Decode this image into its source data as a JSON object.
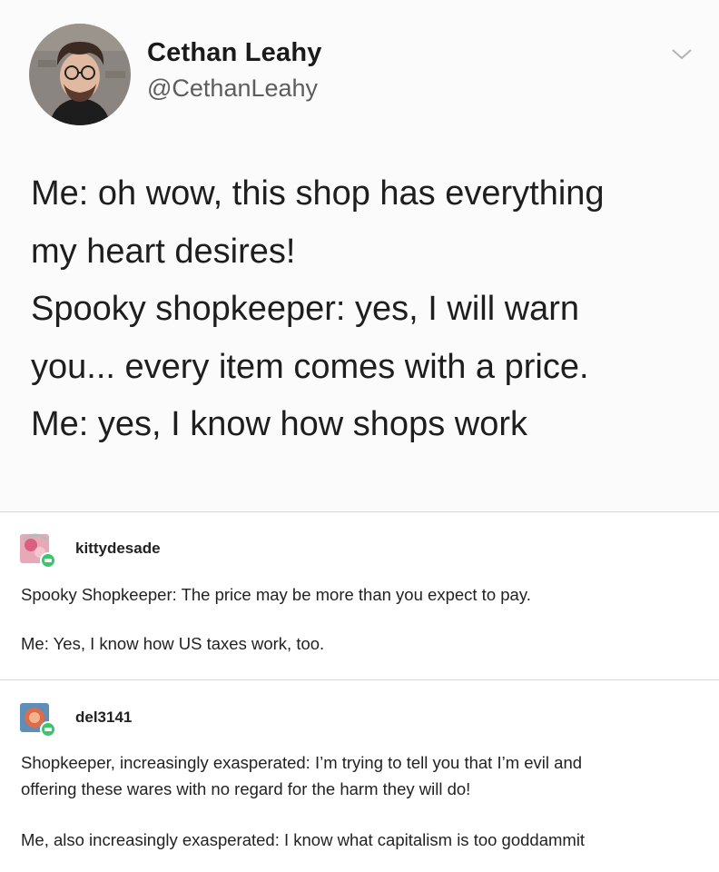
{
  "tweet": {
    "display_name": "Cethan Leahy",
    "handle": "@CethanLeahy",
    "lines": [
      "Me: oh wow, this shop has everything",
      "my heart desires!",
      "Spooky shopkeeper: yes, I will warn",
      "you... every item comes with a price.",
      "Me: yes, I know how shops work"
    ],
    "menu_icon": "chevron-down-icon"
  },
  "replies": [
    {
      "username": "kittydesade",
      "avatar_icon": "user-avatar-icon",
      "badge_icon": "tumblr-badge-icon",
      "paragraphs": [
        [
          "Spooky Shopkeeper: The price may be more than you expect to pay."
        ],
        [
          "Me: Yes, I know how US taxes work, too."
        ]
      ]
    },
    {
      "username": "del3141",
      "avatar_icon": "user-avatar-icon",
      "badge_icon": "tumblr-badge-icon",
      "paragraphs": [
        [
          "Shopkeeper, increasingly exasperated: I’m trying to tell you that I’m evil and",
          "offering these wares with no regard for the harm they will do!"
        ],
        [
          "Me, also increasingly exasperated: I know what capitalism is too goddammit"
        ]
      ]
    }
  ],
  "colors": {
    "text": "#1e1e1e",
    "handle": "#5d5d5d",
    "separator": "#d9d9d9",
    "badge_green": "#3cc46e"
  }
}
